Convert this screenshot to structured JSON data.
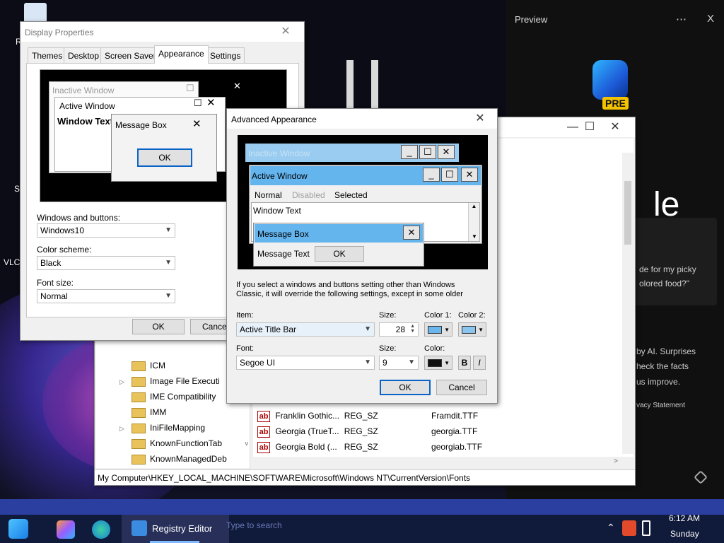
{
  "desktop": {
    "labels": [
      "R",
      "S",
      "VLC"
    ]
  },
  "preview": {
    "title": "Preview",
    "more": "⋯",
    "close": "X",
    "badge": "PRE",
    "big_text": "le",
    "card_text_1": "de for my picky",
    "card_text_2": "olored food?\"",
    "text_3": "by AI. Surprises",
    "text_4": "heck the facts",
    "text_5": "us improve.",
    "text_6": "vacy Statement"
  },
  "display_properties": {
    "title": "Display Properties",
    "tabs": [
      "Themes",
      "Desktop",
      "Screen Saver",
      "Appearance",
      "Settings"
    ],
    "selected_tab": "Appearance",
    "preview": {
      "inactive_title": "Inactive Window",
      "active_title": "Active Window",
      "window_text": "Window Text",
      "msgbox_title": "Message Box",
      "ok": "OK"
    },
    "windows_and_buttons_label": "Windows and buttons:",
    "windows_and_buttons_value": "Windows10",
    "color_scheme_label": "Color scheme:",
    "color_scheme_value": "Black",
    "font_size_label": "Font size:",
    "font_size_value": "Normal",
    "ok_button": "OK",
    "cancel_button": "Cance"
  },
  "advanced": {
    "title": "Advanced Appearance",
    "preview": {
      "inactive_title": "Inactive Window",
      "active_title": "Active Window",
      "menu": [
        "Normal",
        "Disabled",
        "Selected"
      ],
      "window_text": "Window Text",
      "msgbox_title": "Message Box",
      "msg_text": "Message Text",
      "ok": "OK"
    },
    "info_line1": "If you select a windows and buttons setting other than Windows",
    "info_line2": "Classic, it will override the following settings, except in some older",
    "item_label": "Item:",
    "item_value": "Active Title Bar",
    "size_label": "Size:",
    "size_value": "28",
    "color1_label": "Color 1:",
    "color2_label": "Color 2:",
    "color1": "#6cb6ee",
    "color2": "#8cc4f0",
    "font_label": "Font:",
    "font_value": "Segoe UI",
    "font_size_label": "Size:",
    "font_size_value": "9",
    "font_color_label": "Color:",
    "font_color": "#111111",
    "bold": "B",
    "italic": "I",
    "ok_button": "OK",
    "cancel_button": "Cancel"
  },
  "regedit": {
    "tree_items": [
      {
        "label": "ICM",
        "expandable": false
      },
      {
        "label": "Image File Executi",
        "expandable": true
      },
      {
        "label": "IME Compatibility",
        "expandable": false
      },
      {
        "label": "IMM",
        "expandable": false
      },
      {
        "label": "IniFileMapping",
        "expandable": true
      },
      {
        "label": "KnownFunctionTab",
        "expandable": false
      },
      {
        "label": "KnownManagedDeb",
        "expandable": false
      }
    ],
    "values": [
      {
        "name": "Franklin Gothic...",
        "type": "REG_SZ",
        "data": "Framdit.TTF"
      },
      {
        "name": "Georgia (TrueT...",
        "type": "REG_SZ",
        "data": "georgia.TTF"
      },
      {
        "name": "Georgia Bold (...",
        "type": "REG_SZ",
        "data": "georgiab.TTF"
      }
    ],
    "status_path": "My Computer\\HKEY_LOCAL_MACHINE\\SOFTWARE\\Microsoft\\Windows NT\\CurrentVersion\\Fonts"
  },
  "taskbar": {
    "active_app": "Registry Editor",
    "time": "6:12 AM",
    "day": "Sunday",
    "search_hint": "Type to search"
  }
}
